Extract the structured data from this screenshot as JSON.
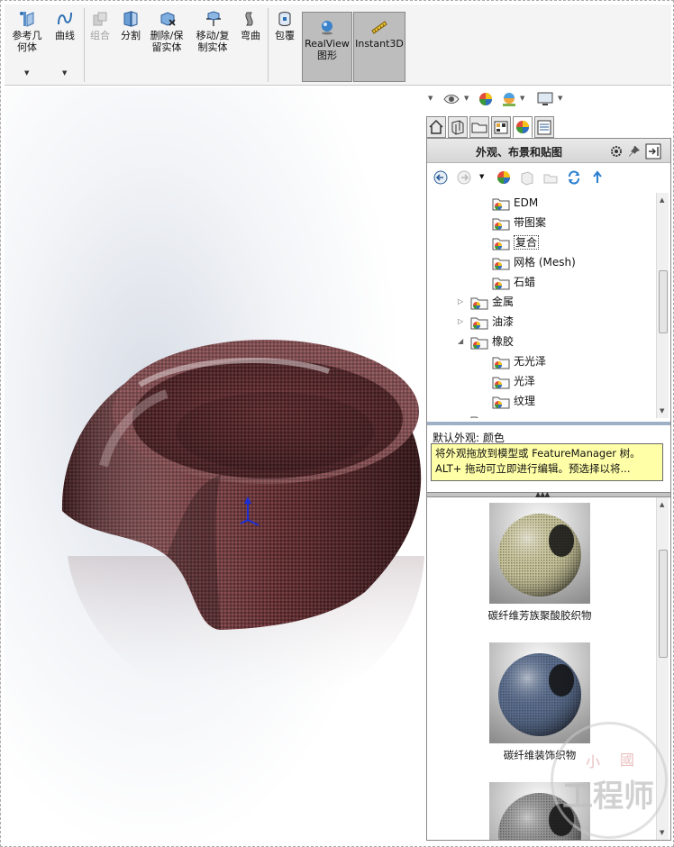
{
  "ribbon": {
    "ref_geometry": "参考几何体",
    "curves": "曲线",
    "combine": "组合",
    "split": "分割",
    "delete_keep_body": "删除/保留实体",
    "move_copy_body": "移动/复制实体",
    "flex": "弯曲",
    "wrap": "包覆",
    "realview": "RealView图形",
    "instant3d": "Instant3D"
  },
  "view_toolbar": {
    "icons": [
      "view-orientation-icon",
      "zoom-to-fit-icon",
      "zoom-area-icon",
      "previous-view-icon",
      "section-view-icon",
      "dynamic-annotation-icon",
      "display-style-icon",
      "hide-show-items-icon",
      "edit-appearance-icon",
      "apply-scene-icon",
      "view-settings-icon"
    ]
  },
  "task_pane": {
    "tabs": [
      "home-tab-icon",
      "design-library-tab-icon",
      "file-explorer-tab-icon",
      "view-palette-tab-icon",
      "appearances-tab-icon",
      "custom-properties-tab-icon"
    ],
    "selected_tab": 4,
    "title": "外观、布景和贴图",
    "tree": [
      {
        "label": "EDM",
        "level": 2
      },
      {
        "label": "带图案",
        "level": 2
      },
      {
        "label": "复合",
        "level": 2,
        "selected": true
      },
      {
        "label": "网格 (Mesh)",
        "level": 2
      },
      {
        "label": "石蜡",
        "level": 2
      },
      {
        "label": "金属",
        "level": 1,
        "expander": "collapsed"
      },
      {
        "label": "油漆",
        "level": 1,
        "expander": "collapsed"
      },
      {
        "label": "橡胶",
        "level": 1,
        "expander": "expanded"
      },
      {
        "label": "无光泽",
        "level": 2
      },
      {
        "label": "光泽",
        "level": 2
      },
      {
        "label": "纹理",
        "level": 2
      }
    ],
    "description_label": "默认外观: 颜色",
    "tooltip_text": "将外观拖放到模型或 FeatureManager 树。ALT+ 拖动可立即进行编辑。预选择以将...",
    "materials": [
      {
        "caption": "碳纤维芳族聚酸胶织物",
        "color": "#c8c49a"
      },
      {
        "caption": "碳纤维装饰织物",
        "color": "#5a6d8e"
      },
      {
        "caption": "",
        "color": "#8f8f8f"
      }
    ]
  },
  "watermark": {
    "top_left": "小",
    "top_right": "國",
    "main": "工程师"
  },
  "colors": {
    "model_body": "#6b3438",
    "pane_divider": "#9fb0c6",
    "tooltip_bg": "#ffffa8"
  }
}
